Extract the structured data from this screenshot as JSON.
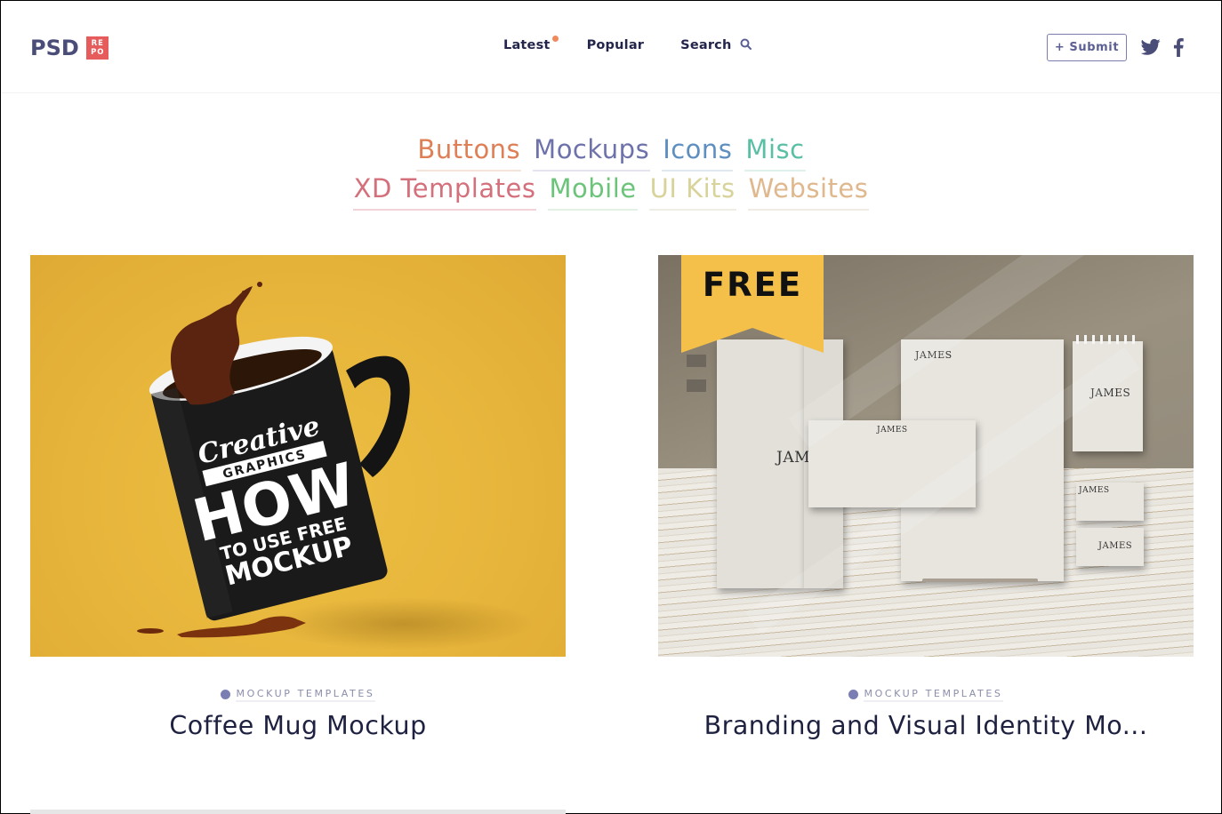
{
  "header": {
    "logo": {
      "primary": "PSD",
      "badge_line1": "RE",
      "badge_line2": "PO",
      "badge_color": "#e65c5c",
      "primary_color": "#4a4d78"
    },
    "nav": [
      {
        "label": "Latest",
        "has_indicator": true,
        "indicator_color": "#f08a5d"
      },
      {
        "label": "Popular"
      },
      {
        "label": "Search",
        "icon": "search-icon"
      }
    ],
    "submit_label": "+ Submit",
    "social": [
      {
        "name": "twitter",
        "icon": "twitter-icon"
      },
      {
        "name": "facebook",
        "icon": "facebook-icon"
      }
    ]
  },
  "categories": {
    "row1": [
      {
        "label": "Buttons",
        "color": "#de7f56"
      },
      {
        "label": "Mockups",
        "color": "#6e72aa"
      },
      {
        "label": "Icons",
        "color": "#5e8fc0"
      },
      {
        "label": "Misc",
        "color": "#5bbfa6"
      }
    ],
    "row2": [
      {
        "label": "XD Templates",
        "color": "#d4707c"
      },
      {
        "label": "Mobile",
        "color": "#6cc47a"
      },
      {
        "label": "UI Kits",
        "color": "#d8d39a"
      },
      {
        "label": "Websites",
        "color": "#e0b88e"
      }
    ]
  },
  "cards": [
    {
      "category": "MOCKUP TEMPLATES",
      "title": "Coffee Mug Mockup",
      "image": {
        "type": "coffee-mug",
        "mug_text": [
          "Creative",
          "GRAPHICS",
          "HOW",
          "TO USE FREE",
          "MOCKUP"
        ],
        "bg_color": "#e8b63c"
      }
    },
    {
      "category": "MOCKUP TEMPLATES",
      "title": "Branding and Visual Identity Mo...",
      "image": {
        "type": "stationery",
        "badge": "FREE",
        "badge_color": "#f4c04a",
        "brand_text": "JAMES",
        "brand_partial": "JAM"
      }
    }
  ]
}
